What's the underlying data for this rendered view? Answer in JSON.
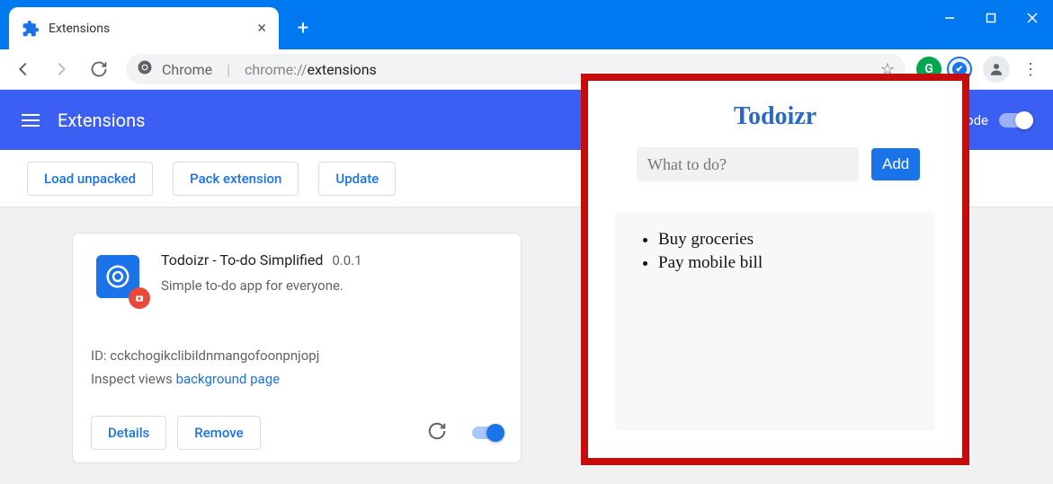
{
  "window": {
    "tab_title": "Extensions"
  },
  "omnibox": {
    "chrome_label": "Chrome",
    "url_prefix": "chrome://",
    "url_strong": "extensions"
  },
  "header": {
    "title": "Extensions",
    "dev_mode_label": "Developer mode"
  },
  "toolbar": {
    "load_unpacked": "Load unpacked",
    "pack_extension": "Pack extension",
    "update": "Update"
  },
  "card": {
    "name": "Todoizr - To-do Simplified",
    "version": "0.0.1",
    "description": "Simple to-do app for everyone.",
    "id_label": "ID: cckchogikclibildnmangofoonpnjopj",
    "inspect_label": "Inspect views",
    "inspect_link": "background page",
    "details_btn": "Details",
    "remove_btn": "Remove"
  },
  "popup": {
    "title": "Todoizr",
    "placeholder": "What to do?",
    "add_btn": "Add",
    "items": {
      "0": "Buy groceries",
      "1": "Pay mobile bill"
    }
  }
}
